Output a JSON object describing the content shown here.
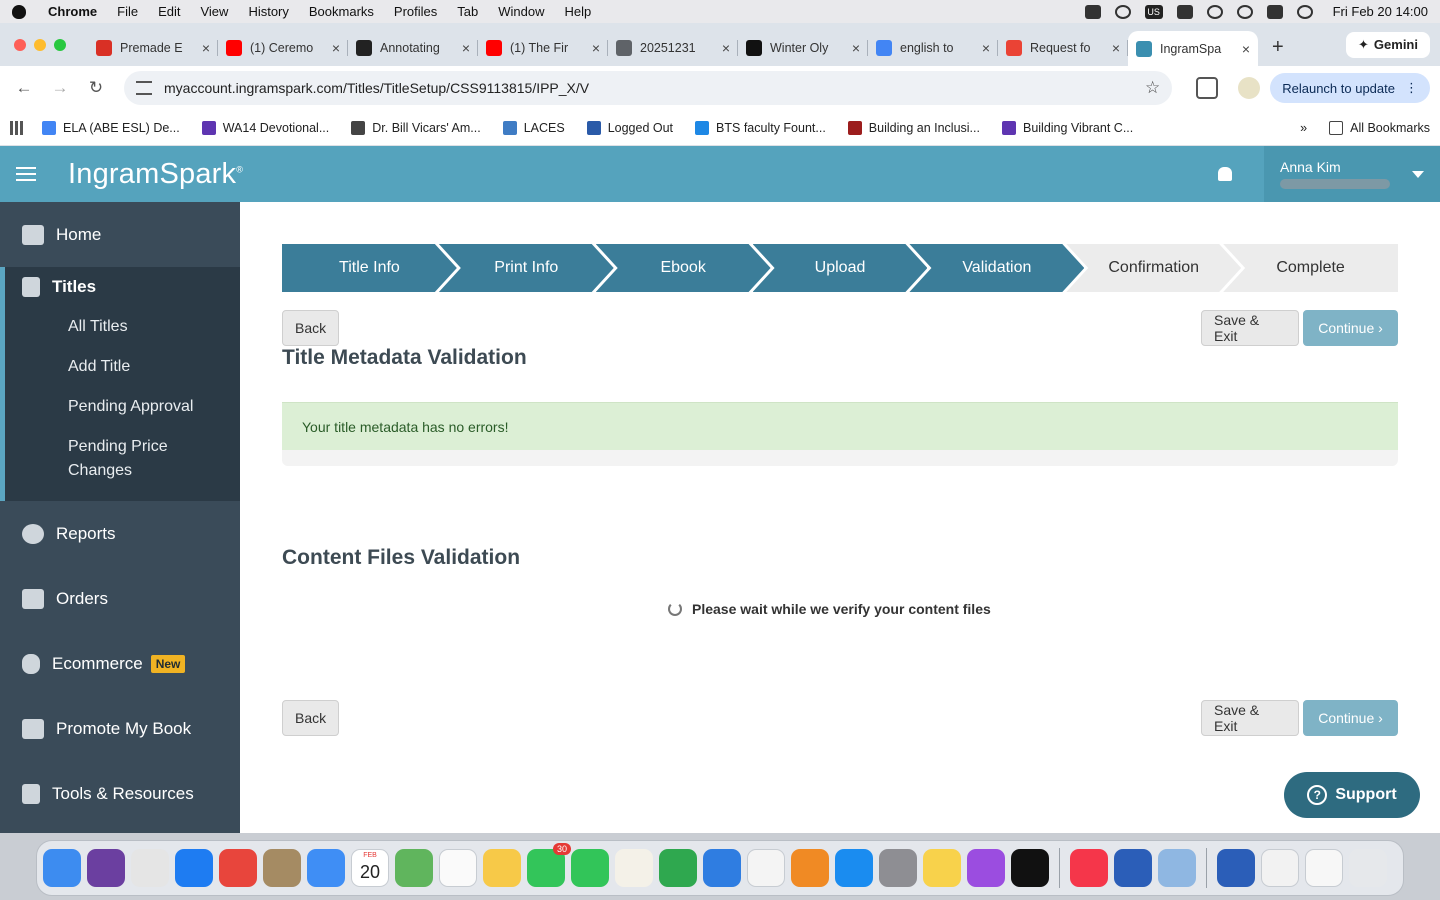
{
  "menubar": {
    "app": "Chrome",
    "items": [
      "File",
      "Edit",
      "View",
      "History",
      "Bookmarks",
      "Profiles",
      "Tab",
      "Window",
      "Help"
    ],
    "input_source": "US",
    "clock": "Fri Feb 20  14:00"
  },
  "tabs": [
    {
      "title": "Premade E",
      "color": "#d93025"
    },
    {
      "title": "(1) Ceremo",
      "color": "#ff0000"
    },
    {
      "title": "Annotating",
      "color": "#222222"
    },
    {
      "title": "(1) The Fir",
      "color": "#ff0000"
    },
    {
      "title": "20251231",
      "color": "#5f6368"
    },
    {
      "title": "Winter Oly",
      "color": "#111111"
    },
    {
      "title": "english to",
      "color": "#4285f4"
    },
    {
      "title": "Request fo",
      "color": "#ea4335"
    },
    {
      "title": "IngramSpa",
      "color": "#3b8fb0",
      "active": true
    }
  ],
  "gemini_label": "Gemini",
  "address": {
    "url": "myaccount.ingramspark.com/Titles/TitleSetup/CSS9113815/IPP_X/V",
    "relaunch": "Relaunch to update"
  },
  "bookmarks": [
    {
      "label": "ELA (ABE ESL) De...",
      "color": "#4285f4"
    },
    {
      "label": "WA14 Devotional...",
      "color": "#5e35b1"
    },
    {
      "label": "Dr. Bill Vicars' Am...",
      "color": "#444444"
    },
    {
      "label": "LACES",
      "color": "#3f7cc4"
    },
    {
      "label": "Logged Out",
      "color": "#2a5aa8"
    },
    {
      "label": "BTS faculty Fount...",
      "color": "#1e88e5"
    },
    {
      "label": "Building an Inclusi...",
      "color": "#9c1d1d"
    },
    {
      "label": "Building Vibrant C...",
      "color": "#5e35b1"
    }
  ],
  "all_bookmarks": "All Bookmarks",
  "header": {
    "brand": "IngramSpark",
    "user_name": "Anna Kim"
  },
  "sidebar": {
    "home": "Home",
    "titles": "Titles",
    "title_subitems": [
      "All Titles",
      "Add Title",
      "Pending Approval",
      "Pending Price Changes"
    ],
    "reports": "Reports",
    "orders": "Orders",
    "ecommerce": "Ecommerce",
    "new_badge": "New",
    "promote": "Promote My Book",
    "tools": "Tools & Resources"
  },
  "steps": [
    {
      "label": "Title Info",
      "done": true
    },
    {
      "label": "Print Info",
      "done": true
    },
    {
      "label": "Ebook",
      "done": true
    },
    {
      "label": "Upload",
      "done": true
    },
    {
      "label": "Validation",
      "done": true
    },
    {
      "label": "Confirmation",
      "done": false
    },
    {
      "label": "Complete",
      "done": false
    }
  ],
  "buttons": {
    "back": "Back",
    "save_exit": "Save & Exit",
    "continue": "Continue ›"
  },
  "metadata": {
    "title": "Title Metadata Validation",
    "success": "Your title metadata has no errors!"
  },
  "content": {
    "title": "Content Files Validation",
    "wait": "Please wait while we verify your content files"
  },
  "support": "Support",
  "dock": {
    "calendar_month": "FEB",
    "calendar_day": "20",
    "messages_badge": "30",
    "apps": [
      {
        "name": "finder",
        "color": "#3d8cf0"
      },
      {
        "name": "siri",
        "color": "#6b3fa0"
      },
      {
        "name": "launchpad",
        "color": "#e5e5e5"
      },
      {
        "name": "safari",
        "color": "#1e7cf2"
      },
      {
        "name": "chrome",
        "color": "#e8453c"
      },
      {
        "name": "contacts",
        "color": "#a58b63"
      },
      {
        "name": "mail",
        "color": "#3f8ef5"
      },
      {
        "name": "calendar",
        "color": "#ffffff"
      },
      {
        "name": "maps",
        "color": "#60b55d"
      },
      {
        "name": "reminders",
        "color": "#fafafa"
      },
      {
        "name": "photos",
        "color": "#f7c948"
      },
      {
        "name": "messages",
        "color": "#33c55a"
      },
      {
        "name": "facetime",
        "color": "#32c559"
      },
      {
        "name": "freeform",
        "color": "#f4f1e8"
      },
      {
        "name": "numbers",
        "color": "#2fa84f"
      },
      {
        "name": "keynote",
        "color": "#2f7de1"
      },
      {
        "name": "news",
        "color": "#f4f4f4"
      },
      {
        "name": "books",
        "color": "#f08a24"
      },
      {
        "name": "app-store",
        "color": "#1a8cf0"
      },
      {
        "name": "settings",
        "color": "#8e8e93"
      },
      {
        "name": "notes",
        "color": "#f8d24b"
      },
      {
        "name": "podcasts",
        "color": "#9b4de0"
      },
      {
        "name": "apple-tv",
        "color": "#111111"
      },
      {
        "name": "music",
        "color": "#f5364a"
      },
      {
        "name": "word",
        "color": "#2b5eb8"
      },
      {
        "name": "preview",
        "color": "#8fb7e2"
      },
      {
        "name": "word-doc",
        "color": "#2b5eb8"
      },
      {
        "name": "document",
        "color": "#f2f2f2"
      },
      {
        "name": "pdf-file",
        "color": "#f7f7f7"
      },
      {
        "name": "trash",
        "color": "#e6e8eb"
      }
    ]
  }
}
